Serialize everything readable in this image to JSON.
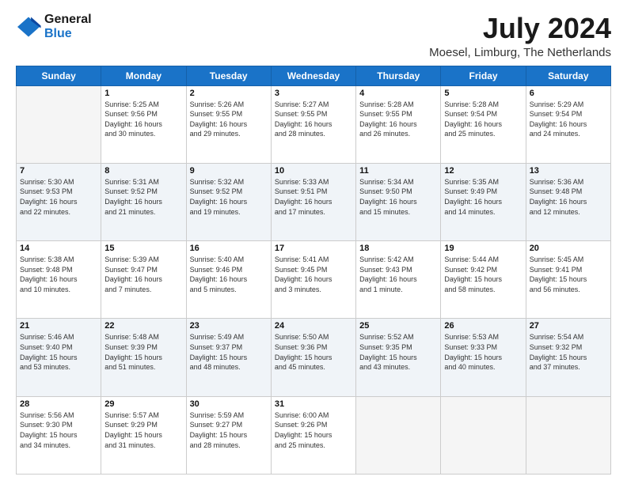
{
  "logo": {
    "line1": "General",
    "line2": "Blue"
  },
  "title": "July 2024",
  "location": "Moesel, Limburg, The Netherlands",
  "headers": [
    "Sunday",
    "Monday",
    "Tuesday",
    "Wednesday",
    "Thursday",
    "Friday",
    "Saturday"
  ],
  "weeks": [
    [
      {
        "day": "",
        "info": ""
      },
      {
        "day": "1",
        "info": "Sunrise: 5:25 AM\nSunset: 9:56 PM\nDaylight: 16 hours\nand 30 minutes."
      },
      {
        "day": "2",
        "info": "Sunrise: 5:26 AM\nSunset: 9:55 PM\nDaylight: 16 hours\nand 29 minutes."
      },
      {
        "day": "3",
        "info": "Sunrise: 5:27 AM\nSunset: 9:55 PM\nDaylight: 16 hours\nand 28 minutes."
      },
      {
        "day": "4",
        "info": "Sunrise: 5:28 AM\nSunset: 9:55 PM\nDaylight: 16 hours\nand 26 minutes."
      },
      {
        "day": "5",
        "info": "Sunrise: 5:28 AM\nSunset: 9:54 PM\nDaylight: 16 hours\nand 25 minutes."
      },
      {
        "day": "6",
        "info": "Sunrise: 5:29 AM\nSunset: 9:54 PM\nDaylight: 16 hours\nand 24 minutes."
      }
    ],
    [
      {
        "day": "7",
        "info": "Sunrise: 5:30 AM\nSunset: 9:53 PM\nDaylight: 16 hours\nand 22 minutes."
      },
      {
        "day": "8",
        "info": "Sunrise: 5:31 AM\nSunset: 9:52 PM\nDaylight: 16 hours\nand 21 minutes."
      },
      {
        "day": "9",
        "info": "Sunrise: 5:32 AM\nSunset: 9:52 PM\nDaylight: 16 hours\nand 19 minutes."
      },
      {
        "day": "10",
        "info": "Sunrise: 5:33 AM\nSunset: 9:51 PM\nDaylight: 16 hours\nand 17 minutes."
      },
      {
        "day": "11",
        "info": "Sunrise: 5:34 AM\nSunset: 9:50 PM\nDaylight: 16 hours\nand 15 minutes."
      },
      {
        "day": "12",
        "info": "Sunrise: 5:35 AM\nSunset: 9:49 PM\nDaylight: 16 hours\nand 14 minutes."
      },
      {
        "day": "13",
        "info": "Sunrise: 5:36 AM\nSunset: 9:48 PM\nDaylight: 16 hours\nand 12 minutes."
      }
    ],
    [
      {
        "day": "14",
        "info": "Sunrise: 5:38 AM\nSunset: 9:48 PM\nDaylight: 16 hours\nand 10 minutes."
      },
      {
        "day": "15",
        "info": "Sunrise: 5:39 AM\nSunset: 9:47 PM\nDaylight: 16 hours\nand 7 minutes."
      },
      {
        "day": "16",
        "info": "Sunrise: 5:40 AM\nSunset: 9:46 PM\nDaylight: 16 hours\nand 5 minutes."
      },
      {
        "day": "17",
        "info": "Sunrise: 5:41 AM\nSunset: 9:45 PM\nDaylight: 16 hours\nand 3 minutes."
      },
      {
        "day": "18",
        "info": "Sunrise: 5:42 AM\nSunset: 9:43 PM\nDaylight: 16 hours\nand 1 minute."
      },
      {
        "day": "19",
        "info": "Sunrise: 5:44 AM\nSunset: 9:42 PM\nDaylight: 15 hours\nand 58 minutes."
      },
      {
        "day": "20",
        "info": "Sunrise: 5:45 AM\nSunset: 9:41 PM\nDaylight: 15 hours\nand 56 minutes."
      }
    ],
    [
      {
        "day": "21",
        "info": "Sunrise: 5:46 AM\nSunset: 9:40 PM\nDaylight: 15 hours\nand 53 minutes."
      },
      {
        "day": "22",
        "info": "Sunrise: 5:48 AM\nSunset: 9:39 PM\nDaylight: 15 hours\nand 51 minutes."
      },
      {
        "day": "23",
        "info": "Sunrise: 5:49 AM\nSunset: 9:37 PM\nDaylight: 15 hours\nand 48 minutes."
      },
      {
        "day": "24",
        "info": "Sunrise: 5:50 AM\nSunset: 9:36 PM\nDaylight: 15 hours\nand 45 minutes."
      },
      {
        "day": "25",
        "info": "Sunrise: 5:52 AM\nSunset: 9:35 PM\nDaylight: 15 hours\nand 43 minutes."
      },
      {
        "day": "26",
        "info": "Sunrise: 5:53 AM\nSunset: 9:33 PM\nDaylight: 15 hours\nand 40 minutes."
      },
      {
        "day": "27",
        "info": "Sunrise: 5:54 AM\nSunset: 9:32 PM\nDaylight: 15 hours\nand 37 minutes."
      }
    ],
    [
      {
        "day": "28",
        "info": "Sunrise: 5:56 AM\nSunset: 9:30 PM\nDaylight: 15 hours\nand 34 minutes."
      },
      {
        "day": "29",
        "info": "Sunrise: 5:57 AM\nSunset: 9:29 PM\nDaylight: 15 hours\nand 31 minutes."
      },
      {
        "day": "30",
        "info": "Sunrise: 5:59 AM\nSunset: 9:27 PM\nDaylight: 15 hours\nand 28 minutes."
      },
      {
        "day": "31",
        "info": "Sunrise: 6:00 AM\nSunset: 9:26 PM\nDaylight: 15 hours\nand 25 minutes."
      },
      {
        "day": "",
        "info": ""
      },
      {
        "day": "",
        "info": ""
      },
      {
        "day": "",
        "info": ""
      }
    ]
  ]
}
